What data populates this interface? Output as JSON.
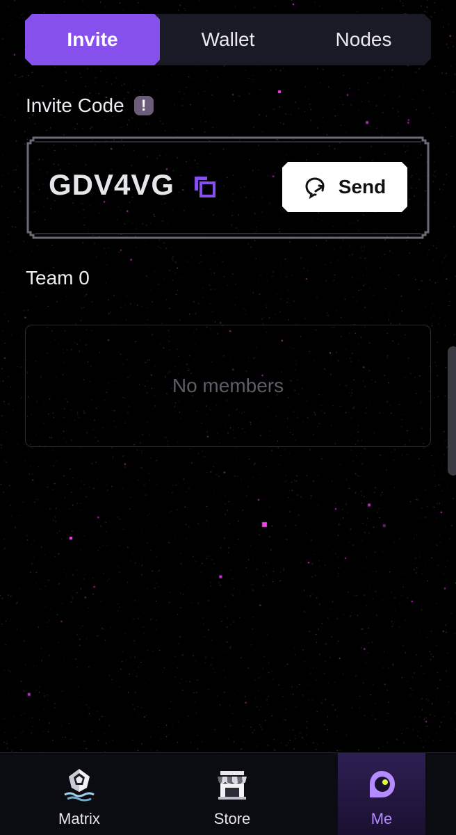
{
  "tabs": [
    {
      "label": "Invite",
      "active": true
    },
    {
      "label": "Wallet",
      "active": false
    },
    {
      "label": "Nodes",
      "active": false
    }
  ],
  "invite": {
    "heading": "Invite Code",
    "info_icon": "!",
    "code": "GDV4VG",
    "send_label": "Send"
  },
  "team": {
    "label": "Team 0",
    "empty_text": "No members"
  },
  "nav": {
    "items": [
      {
        "label": "Matrix",
        "icon": "matrix-crystal-icon"
      },
      {
        "label": "Store",
        "icon": "store-icon"
      },
      {
        "label": "Me",
        "icon": "avatar-icon",
        "active": true
      }
    ]
  },
  "colors": {
    "accent": "#8650ec",
    "background": "#000000",
    "tab_bar": "#1a1a26",
    "card_border": "#6b6b78",
    "muted_text": "#5d5d66"
  }
}
